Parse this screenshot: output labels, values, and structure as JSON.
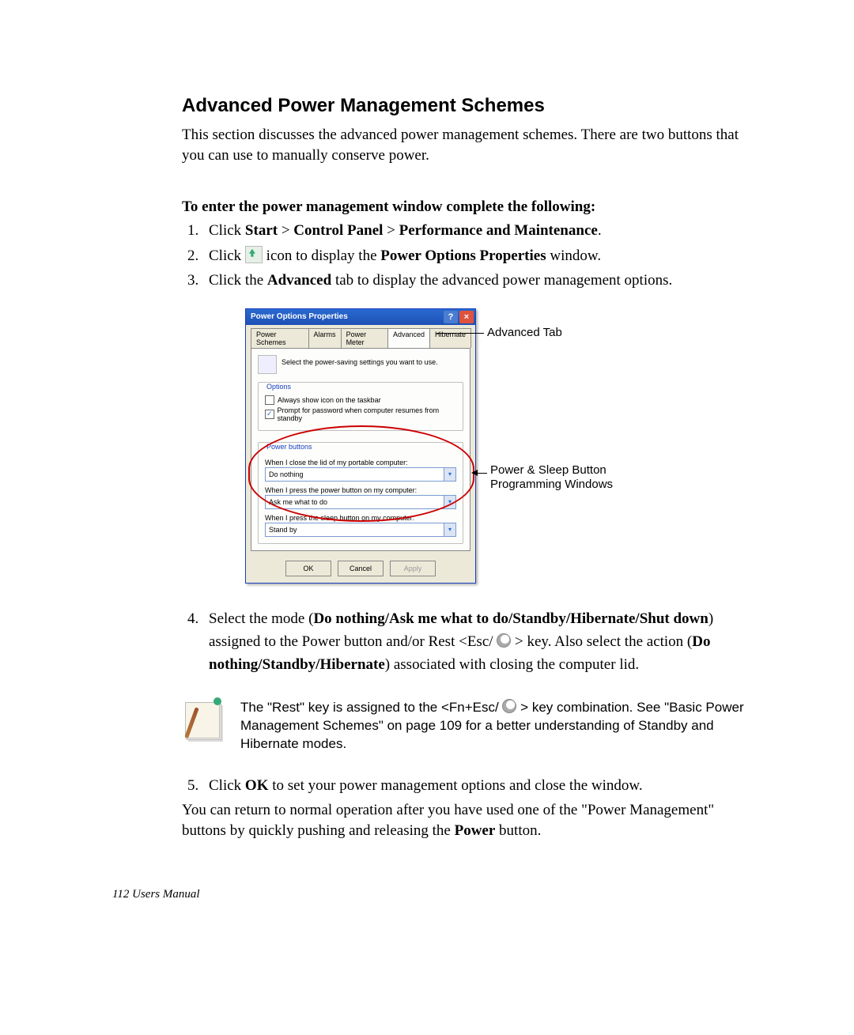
{
  "heading": "Advanced Power Management Schemes",
  "intro": "This section discusses the advanced power management schemes. There are two buttons that you can use to manually conserve power.",
  "sub_heading": "To enter the power management window complete the following:",
  "steps": {
    "s1": {
      "pre": "Click ",
      "b1": "Start",
      "gt1": " > ",
      "b2": "Control Panel",
      "gt2": " > ",
      "b3": "Performance and Maintenance",
      "post": "."
    },
    "s2": {
      "pre": "Click ",
      "post": " icon to display the ",
      "b": "Power Options Properties",
      "post2": " window."
    },
    "s3": {
      "pre": "Click the ",
      "b": "Advanced",
      "post": " tab to display the advanced power management options."
    },
    "s4": {
      "pre": "Select the mode (",
      "b1": "Do nothing/Ask me what to do/Standby/Hibernate/Shut down",
      "mid1": ") assigned to the Power button and/or Rest <Esc/ ",
      "mid2": " > key. Also select the action (",
      "b2": "Do nothing/Standby/Hibernate",
      "post": ") associated with closing the computer lid."
    },
    "s5": {
      "pre": "Click ",
      "b": "OK",
      "post": " to set your power management options and close the window."
    }
  },
  "after_steps": {
    "t1": "You can return to normal operation after you have used one of the \"Power Management\" buttons by quickly pushing and releasing the ",
    "b": "Power",
    "t2": " button."
  },
  "note": {
    "t1": "The \"Rest\" key is assigned to the <Fn+Esc/ ",
    "t2": " > key combination. See  \"Basic Power Management Schemes\" on page 109 for a better understanding of Standby and Hibernate modes."
  },
  "dialog": {
    "title": "Power Options Properties",
    "tabs": {
      "t1": "Power Schemes",
      "t2": "Alarms",
      "t3": "Power Meter",
      "t4": "Advanced",
      "t5": "Hibernate"
    },
    "desc": "Select the power-saving settings you want to use.",
    "group1": "Options",
    "cb1": "Always show icon on the taskbar",
    "cb2": "Prompt for password when computer resumes from standby",
    "group2": "Power buttons",
    "q1": "When I close the lid of my portable computer:",
    "v1": "Do nothing",
    "q2": "When I press the power button on my computer:",
    "v2": "Ask me what to do",
    "q3": "When I press the sleep button on my computer:",
    "v3": "Stand by",
    "btn_ok": "OK",
    "btn_cancel": "Cancel",
    "btn_apply": "Apply"
  },
  "callouts": {
    "advanced_tab": "Advanced Tab",
    "prog_win_1": "Power  & Sleep Button",
    "prog_win_2": "Programming Windows"
  },
  "footer": "112  Users Manual"
}
